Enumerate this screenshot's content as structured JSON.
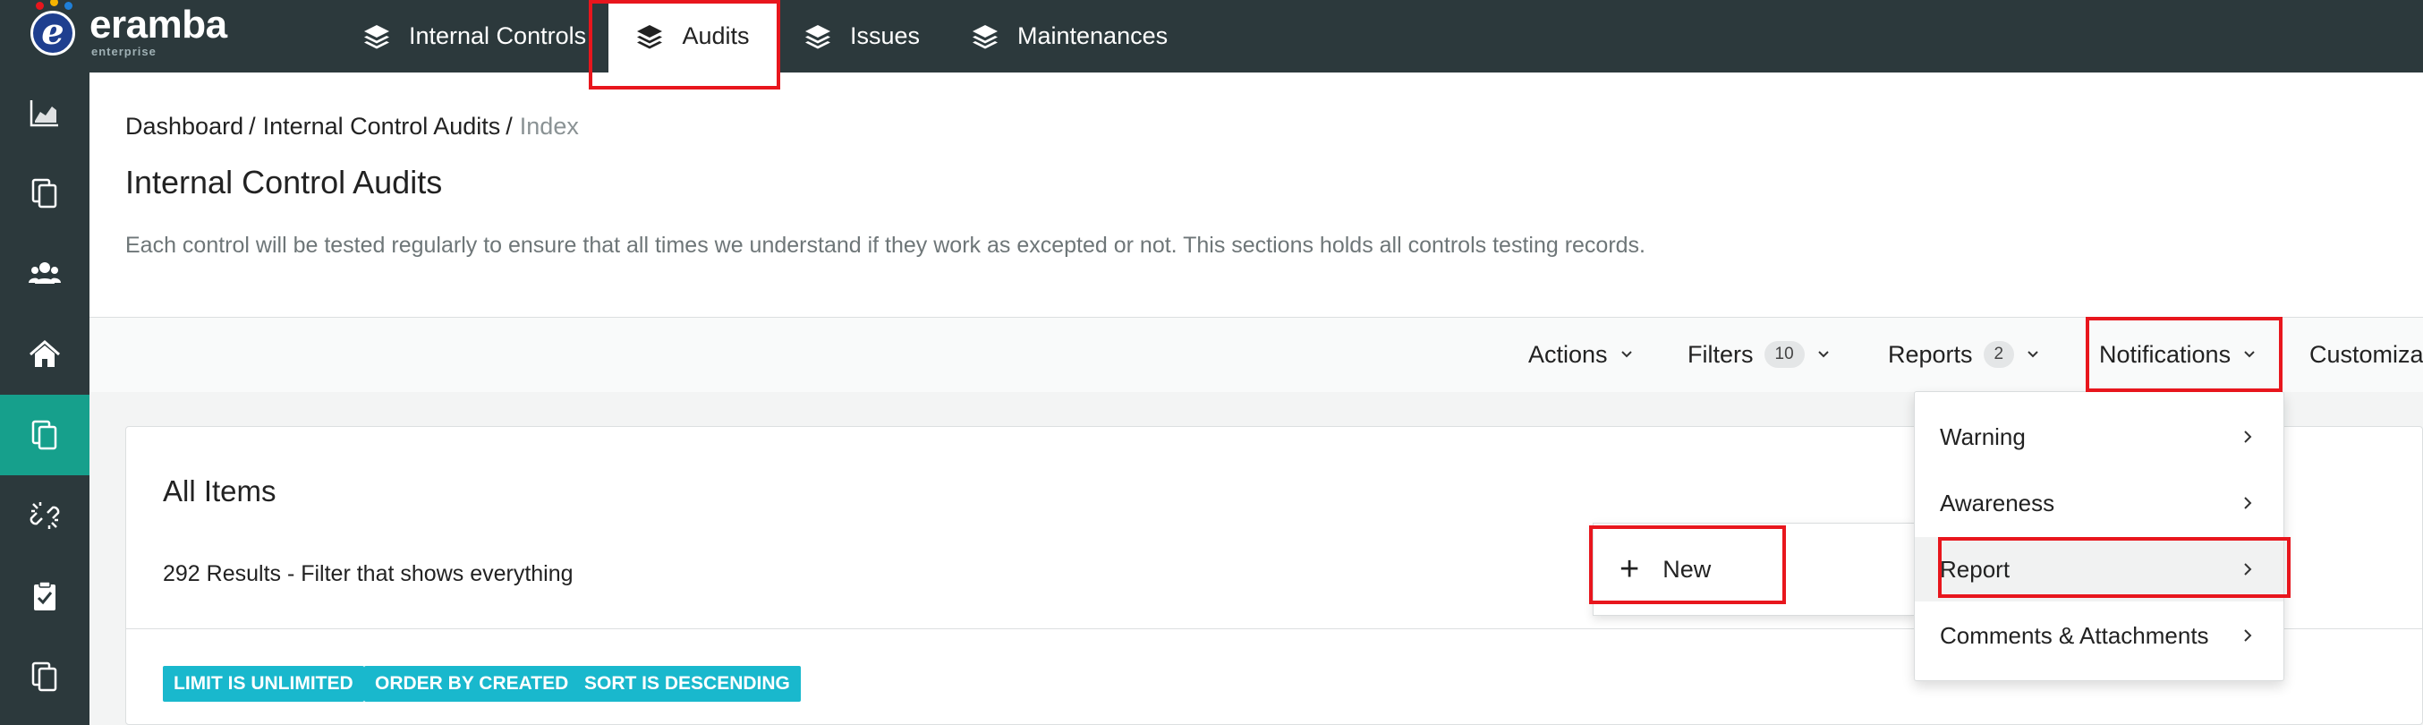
{
  "app": {
    "brand": "eramba",
    "brand_sub": "enterprise",
    "logo_letter": "e"
  },
  "nav": {
    "items": [
      {
        "label": "Internal Controls"
      },
      {
        "label": "Audits"
      },
      {
        "label": "Issues"
      },
      {
        "label": "Maintenances"
      }
    ]
  },
  "sidebar": {
    "icons": [
      "chart-icon",
      "copy-icon",
      "users-icon",
      "home-icon",
      "documents-icon",
      "unlink-icon",
      "clipboard-check-icon",
      "files-icon"
    ]
  },
  "breadcrumb": {
    "items": [
      "Dashboard",
      "Internal Control Audits",
      "Index"
    ],
    "separator": "/"
  },
  "page": {
    "title": "Internal Control Audits",
    "description": "Each control will be tested regularly to ensure that all times we understand if they work as excepted or not. This sections holds all controls testing records."
  },
  "toolbar": {
    "actions_label": "Actions",
    "filters_label": "Filters",
    "filters_count": "10",
    "reports_label": "Reports",
    "reports_count": "2",
    "notifications_label": "Notifications",
    "customize_label": "Customiza"
  },
  "notifications_menu": {
    "items": [
      "Warning",
      "Awareness",
      "Report",
      "Comments & Attachments"
    ]
  },
  "new_menu": {
    "label": "New"
  },
  "card": {
    "title": "All Items",
    "results": "292 Results - Filter that shows everything",
    "tags": [
      "LIMIT IS UNLIMITED",
      "ORDER BY CREATED",
      "SORT IS DESCENDING"
    ]
  },
  "colors": {
    "topbar": "#2c393c",
    "accent": "#16a08c",
    "tag": "#19b8cd",
    "highlight": "#e8161d"
  }
}
